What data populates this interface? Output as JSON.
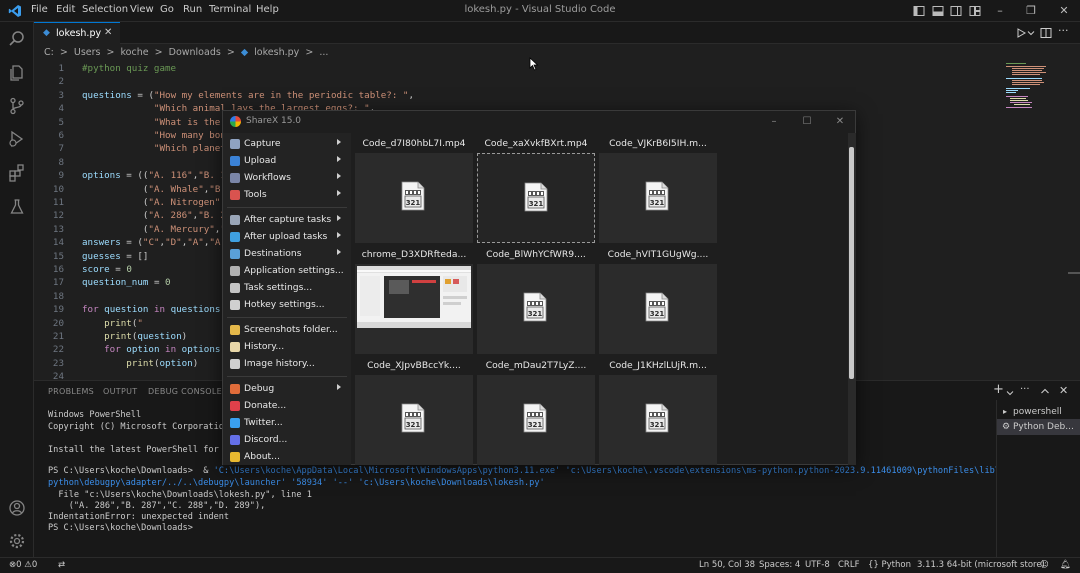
{
  "titlebar": {
    "menu": [
      "File",
      "Edit",
      "Selection",
      "View",
      "Go",
      "Run",
      "Terminal",
      "Help"
    ],
    "window_title": "lokesh.py - Visual Studio Code"
  },
  "tabs": [
    {
      "label": "lokesh.py"
    }
  ],
  "breadcrumb": [
    "C:",
    ">",
    "Users",
    ">",
    "koche",
    ">",
    "Downloads",
    ">",
    "lokesh.py",
    ">",
    "..."
  ],
  "editor": {
    "line_numbers": [
      "1",
      "2",
      "3",
      "4",
      "5",
      "6",
      "7",
      "8",
      "9",
      "10",
      "11",
      "12",
      "13",
      "14",
      "15",
      "16",
      "17",
      "18",
      "19",
      "20",
      "21",
      "22",
      "23",
      "24"
    ],
    "lines": [
      "#python quiz game",
      "",
      "questions = (\"How my elements are in the periodic table?: \",",
      "             \"Which animal lays the largest eggs?: \",",
      "             \"What is the",
      "             \"How many bon",
      "             \"Which planet",
      "",
      "options = ((\"A. 116\",\"B. 1",
      "           (\"A. Whale\",\"B.",
      "           (\"A. Nitrogen\",",
      "           (\"A. 286\",\"B. 2",
      "           (\"A. Mercury\",\"",
      "answers = (\"C\",\"D\",\"A\",\"A\"",
      "guesses = []",
      "score = 0",
      "question_num = 0",
      "",
      "for question in questions:",
      "    print(\"",
      "    print(question)",
      "    for option in options[",
      "        print(option)",
      ""
    ]
  },
  "panel": {
    "tabs": [
      "PROBLEMS",
      "OUTPUT",
      "DEBUG CONSOLE"
    ],
    "terminal_lines": [
      "Windows PowerShell",
      "Copyright (C) Microsoft Corporation",
      "",
      "Install the latest PowerShell for n",
      "",
      "PS C:\\Users\\koche\\Downloads>  & ",
      "python\\debugpy\\adapter/../..\\debugpy\\launcher' '58934' '--' 'c:\\Users\\koche\\Downloads\\lokesh.py'",
      "  File \"c:\\Users\\koche\\Downloads\\lokesh.py\", line 1",
      "    (\"A. 286\",\"B. 287\",\"C. 288\",\"D. 289\"),",
      "IndentationError: unexpected indent",
      "PS C:\\Users\\koche\\Downloads>"
    ],
    "command_path": "'C:\\Users\\koche\\AppData\\Local\\Microsoft\\WindowsApps\\python3.11.exe' 'c:\\Users\\koche\\.vscode\\extensions\\ms-python.python-2023.9.11461009\\pythonFiles\\lib\\",
    "terminals": [
      "powershell",
      "Python Deb..."
    ]
  },
  "statusbar": {
    "errors": "0",
    "warnings": "0",
    "position": "Ln 50, Col 38",
    "spaces": "Spaces: 4",
    "encoding": "UTF-8",
    "eol": "CRLF",
    "language": "Python",
    "interpreter": "3.11.3 64-bit (microsoft store)"
  },
  "sharex": {
    "title": "ShareX 15.0",
    "menu": [
      {
        "label": "Capture",
        "icon": "capture-icon",
        "color": "#8fa3c2",
        "submenu": true
      },
      {
        "label": "Upload",
        "icon": "upload-icon",
        "color": "#3b82d6",
        "submenu": true
      },
      {
        "label": "Workflows",
        "icon": "workflows-icon",
        "color": "#7b86a8",
        "submenu": true
      },
      {
        "label": "Tools",
        "icon": "tools-icon",
        "color": "#d9534f",
        "submenu": true
      },
      {
        "label": "After capture tasks",
        "icon": "after-capture-icon",
        "color": "#9aa6b8",
        "submenu": true
      },
      {
        "label": "After upload tasks",
        "icon": "after-upload-icon",
        "color": "#3fa0e0",
        "submenu": true
      },
      {
        "label": "Destinations",
        "icon": "destinations-icon",
        "color": "#5aa0d8",
        "submenu": true
      },
      {
        "label": "Application settings...",
        "icon": "wrench-icon",
        "color": "#b0b0b0",
        "submenu": false
      },
      {
        "label": "Task settings...",
        "icon": "task-settings-icon",
        "color": "#c4c4c4",
        "submenu": false
      },
      {
        "label": "Hotkey settings...",
        "icon": "keyboard-icon",
        "color": "#d0d0d0",
        "submenu": false
      },
      {
        "label": "Screenshots folder...",
        "icon": "folder-icon",
        "color": "#e4b84a",
        "submenu": false
      },
      {
        "label": "History...",
        "icon": "history-icon",
        "color": "#e8d7a8",
        "submenu": false
      },
      {
        "label": "Image history...",
        "icon": "image-history-icon",
        "color": "#cfcfcf",
        "submenu": false
      },
      {
        "label": "Debug",
        "icon": "debug-icon",
        "color": "#e06c3a",
        "submenu": true
      },
      {
        "label": "Donate...",
        "icon": "heart-icon",
        "color": "#e0404a",
        "submenu": false
      },
      {
        "label": "Twitter...",
        "icon": "twitter-icon",
        "color": "#3aa0f0",
        "submenu": false
      },
      {
        "label": "Discord...",
        "icon": "discord-icon",
        "color": "#6570e8",
        "submenu": false
      },
      {
        "label": "About...",
        "icon": "crown-icon",
        "color": "#e8b830",
        "submenu": false
      }
    ],
    "files": [
      {
        "name": "Code_d7I80hbL7I.mp4",
        "kind": "video"
      },
      {
        "name": "Code_xaXvkfBXrt.mp4",
        "kind": "video",
        "selected": true
      },
      {
        "name": "Code_VJKrB6I5IH.m...",
        "kind": "video"
      },
      {
        "name": "chrome_D3XDRfteda...",
        "kind": "screenshot"
      },
      {
        "name": "Code_BlWhYCfWR9....",
        "kind": "video"
      },
      {
        "name": "Code_hVIT1GUgWg....",
        "kind": "video"
      },
      {
        "name": "Code_XJpvBBccYk....",
        "kind": "video"
      },
      {
        "name": "Code_mDau2T7LyZ....",
        "kind": "video"
      },
      {
        "name": "Code_J1KHzlLUjR.m...",
        "kind": "video"
      }
    ]
  }
}
